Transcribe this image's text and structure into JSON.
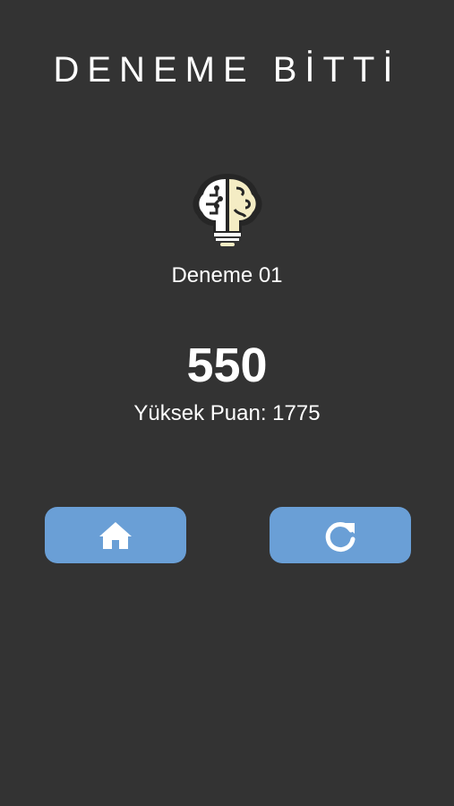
{
  "header": {
    "title": "DENEME BİTTİ"
  },
  "result": {
    "level_name": "Deneme 01",
    "score": "550",
    "high_score_text": "Yüksek Puan: 1775"
  },
  "buttons": {
    "home_icon": "home-icon",
    "retry_icon": "restart-icon"
  },
  "colors": {
    "background": "#333333",
    "button": "#6a9fd6",
    "text": "#ffffff",
    "brain_left": "#ffffff",
    "brain_right": "#f4ecc4"
  }
}
